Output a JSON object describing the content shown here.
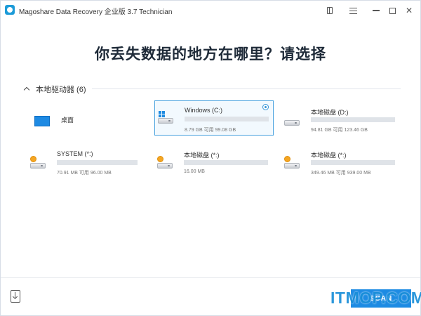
{
  "window": {
    "title": "Magoshare Data Recovery 企业版 3.7 Technician"
  },
  "headline": "你丢失数据的地方在哪里？请选择",
  "section": {
    "title": "本地驱动器 (6)"
  },
  "drives": [
    {
      "name": "桌面",
      "size_text": "",
      "used_fraction": null,
      "selected": false
    },
    {
      "name": "Windows (C:)",
      "size_text": "8.79 GB 可用 99.08 GB",
      "used_fraction": 0.91,
      "selected": true
    },
    {
      "name": "本地磁盘 (D:)",
      "size_text": "94.81 GB 可用 123.46 GB",
      "used_fraction": 0.23,
      "selected": false
    },
    {
      "name": "SYSTEM (*:)",
      "size_text": "70.91 MB 可用 96.00 MB",
      "used_fraction": 0.26,
      "selected": false
    },
    {
      "name": "本地磁盘 (*:)",
      "size_text": "16.00 MB",
      "used_fraction": 1.0,
      "selected": false
    },
    {
      "name": "本地磁盘 (*:)",
      "size_text": "349.46 MB 可用 939.00 MB",
      "used_fraction": 0.63,
      "selected": false
    }
  ],
  "footer": {
    "scan_label": "SCAN",
    "watermark": "ITMOP.COM"
  },
  "icons": {
    "app": "app-logo-icon",
    "bookmark": "book-icon",
    "menu": "menu-icon",
    "import": "import-icon"
  },
  "colors": {
    "accent": "#1d8be3",
    "bar_used": "#1f8ae1",
    "bar_full": "#f5a623",
    "bar_track": "#dfe3e8"
  }
}
